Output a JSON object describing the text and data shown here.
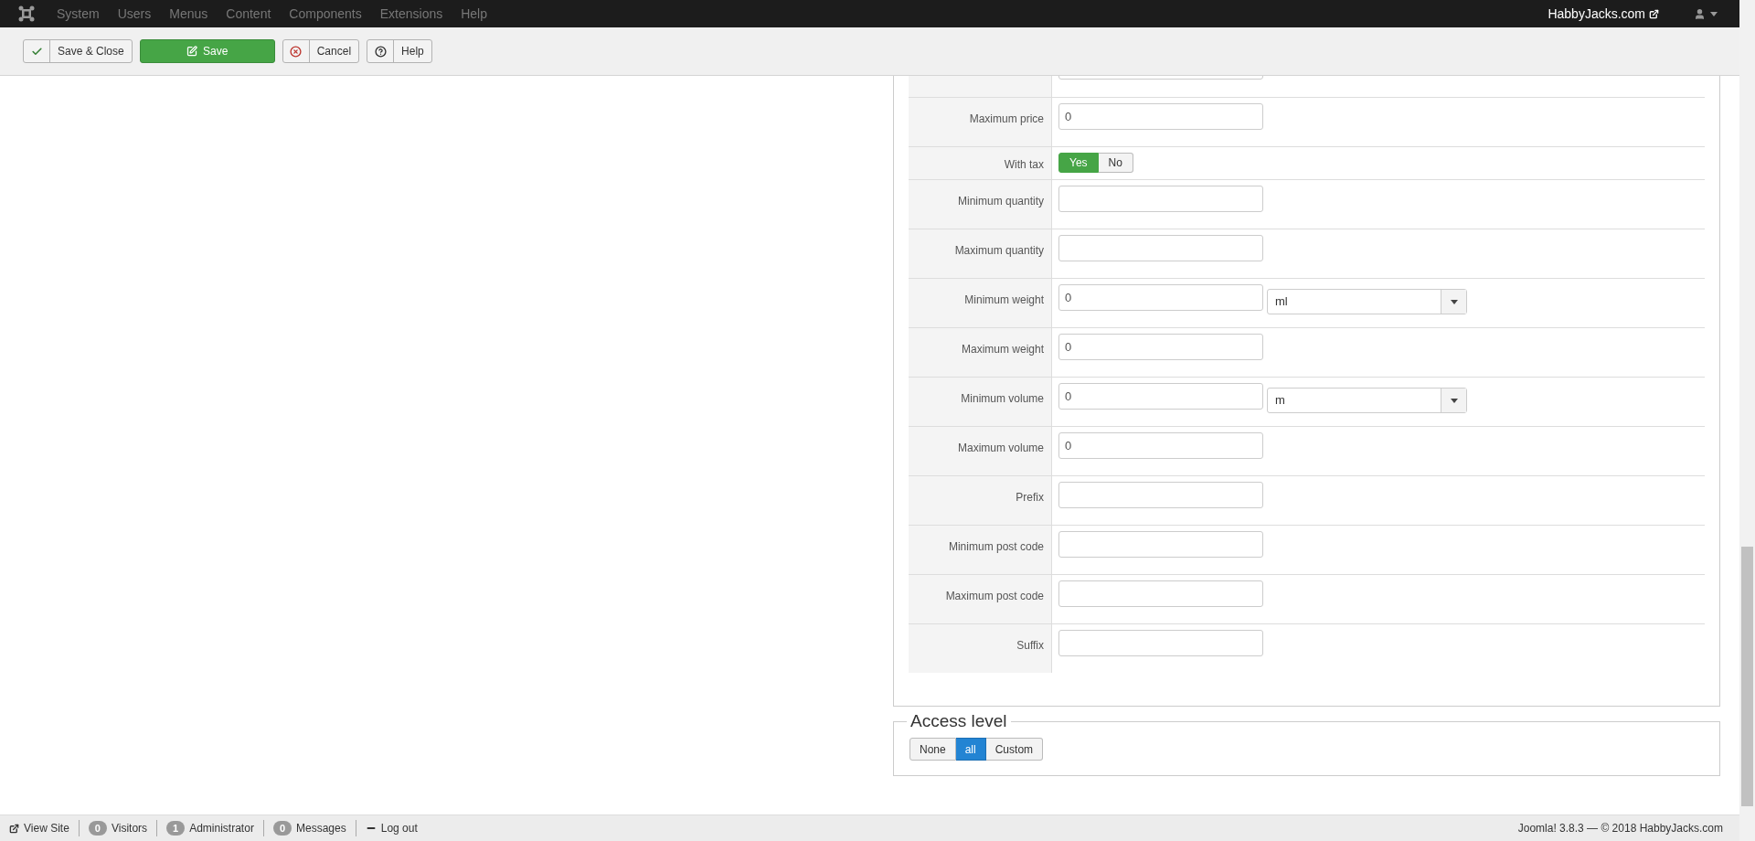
{
  "navbar": {
    "menu": [
      "System",
      "Users",
      "Menus",
      "Content",
      "Components",
      "Extensions",
      "Help"
    ],
    "site_link": "HabbyJacks.com"
  },
  "toolbar": [
    {
      "kind": "save-close",
      "label": "Save & Close"
    },
    {
      "kind": "save",
      "label": "Save"
    },
    {
      "kind": "cancel",
      "label": "Cancel"
    },
    {
      "kind": "help",
      "label": "Help"
    }
  ],
  "form": {
    "rows": [
      {
        "kind": "input"
      },
      {
        "kind": "input",
        "label": "Maximum price",
        "value": "0"
      },
      {
        "kind": "toggle",
        "label": "With tax",
        "options": [
          {
            "label": "Yes",
            "selected": true
          },
          {
            "label": "No",
            "selected": false
          }
        ]
      },
      {
        "kind": "input",
        "label": "Minimum quantity"
      },
      {
        "kind": "input",
        "label": "Maximum quantity"
      },
      {
        "kind": "input_unit",
        "label": "Minimum weight",
        "value": "0",
        "unit": "ml"
      },
      {
        "kind": "input",
        "label": "Maximum weight",
        "value": "0"
      },
      {
        "kind": "input_unit",
        "label": "Minimum volume",
        "value": "0",
        "unit": "m"
      },
      {
        "kind": "input",
        "label": "Maximum volume",
        "value": "0"
      },
      {
        "kind": "input",
        "label": "Prefix"
      },
      {
        "kind": "input",
        "label": "Minimum post code"
      },
      {
        "kind": "input",
        "label": "Maximum post code"
      },
      {
        "kind": "input",
        "label": "Suffix"
      }
    ]
  },
  "access": {
    "legend": "Access level",
    "options": [
      {
        "label": "None",
        "selected": false
      },
      {
        "label": "all",
        "selected": true
      },
      {
        "label": "Custom",
        "selected": false
      }
    ]
  },
  "footer": {
    "items": [
      {
        "kind": "view-site",
        "label": "View Site"
      },
      {
        "kind": "count",
        "count": "0",
        "label": "Visitors"
      },
      {
        "kind": "count",
        "count": "1",
        "label": "Administrator"
      },
      {
        "kind": "count",
        "count": "0",
        "label": "Messages"
      },
      {
        "kind": "logout",
        "label": "Log out"
      }
    ],
    "copyright": "Joomla! 3.8.3 — © 2018 HabbyJacks.com"
  }
}
